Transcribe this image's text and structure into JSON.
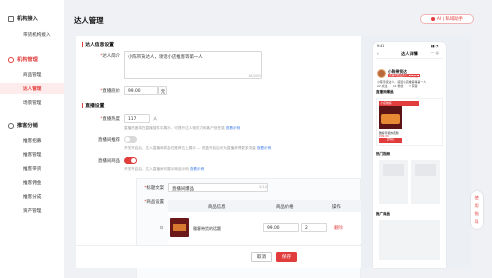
{
  "sidebar": {
    "groups": [
      {
        "label": "机构接入",
        "items": [
          "带货机构接入"
        ]
      },
      {
        "label": "机构管理",
        "items": [
          "商品管理",
          "达人管理",
          "场景管理"
        ]
      },
      {
        "label": "推客分销",
        "items": [
          "推客招募",
          "推客管理",
          "推客带货",
          "推客佣金",
          "推客分成",
          "资产管理"
        ]
      }
    ]
  },
  "header": {
    "title": "达人管理",
    "ai_button": "AI | 私域助手"
  },
  "form": {
    "section1_title": "达人信息设置",
    "intro_label": "*达人简介",
    "intro_value": "小陈带货达人，领话小店推客等第一人",
    "intro_counter": "18/200",
    "price_label": "*直播底价",
    "price_value": "99.00",
    "price_unit": "元",
    "section2_title": "直播设置",
    "popularity_label": "*直播热度",
    "popularity_value": "117",
    "popularity_unit": "人",
    "popularity_hint": "直播热度将在直播插件中展示，可提升达人相关力和客户信任感",
    "popularity_hint_link": "查看示例",
    "pin_label": "直播间推荐",
    "pin_hint": "开关开启后，达人直播间将会在推荐位上展示 — 领盒开启后可为直播获得更多流量",
    "pin_hint_link": "查看示例",
    "goods_label": "直播间商品",
    "goods_hint": "开关开启后，达人直播间可展示商品示例",
    "goods_hint_link": "查看示例",
    "text_label": "*标题文案",
    "text_value": "直播间爆品",
    "text_counter": "5/10",
    "goods_setting_label": "*商品设置",
    "table": {
      "headers": [
        "商品信息",
        "商品价格",
        "操作"
      ],
      "rows": [
        {
          "name": "雅客带货的话题",
          "price": "99.00",
          "qty": "2",
          "action": "删除"
        }
      ]
    }
  },
  "footer": {
    "cancel": "取消",
    "save": "保存"
  },
  "preview": {
    "status_time": "9:41",
    "status_icons": "▮▮ ◔",
    "title": "达人详情",
    "name": "小陈带货达",
    "tag1": "直播间热度达人",
    "tag2": "粉丝数",
    "desc": "小陈带货达人，领话小店推客等第一人",
    "stats": [
      "22 关注",
      "11 粉丝",
      "7 获赞"
    ],
    "live_section": "直播间爆品",
    "live_title": "小店推客",
    "live_text": "雅客带货的话题",
    "live_price": "¥99.00",
    "live_btn": "去购买",
    "section_recommend": "热门视频",
    "section_more": "推广商品"
  },
  "float_tab": {
    "label": "使用指导"
  }
}
